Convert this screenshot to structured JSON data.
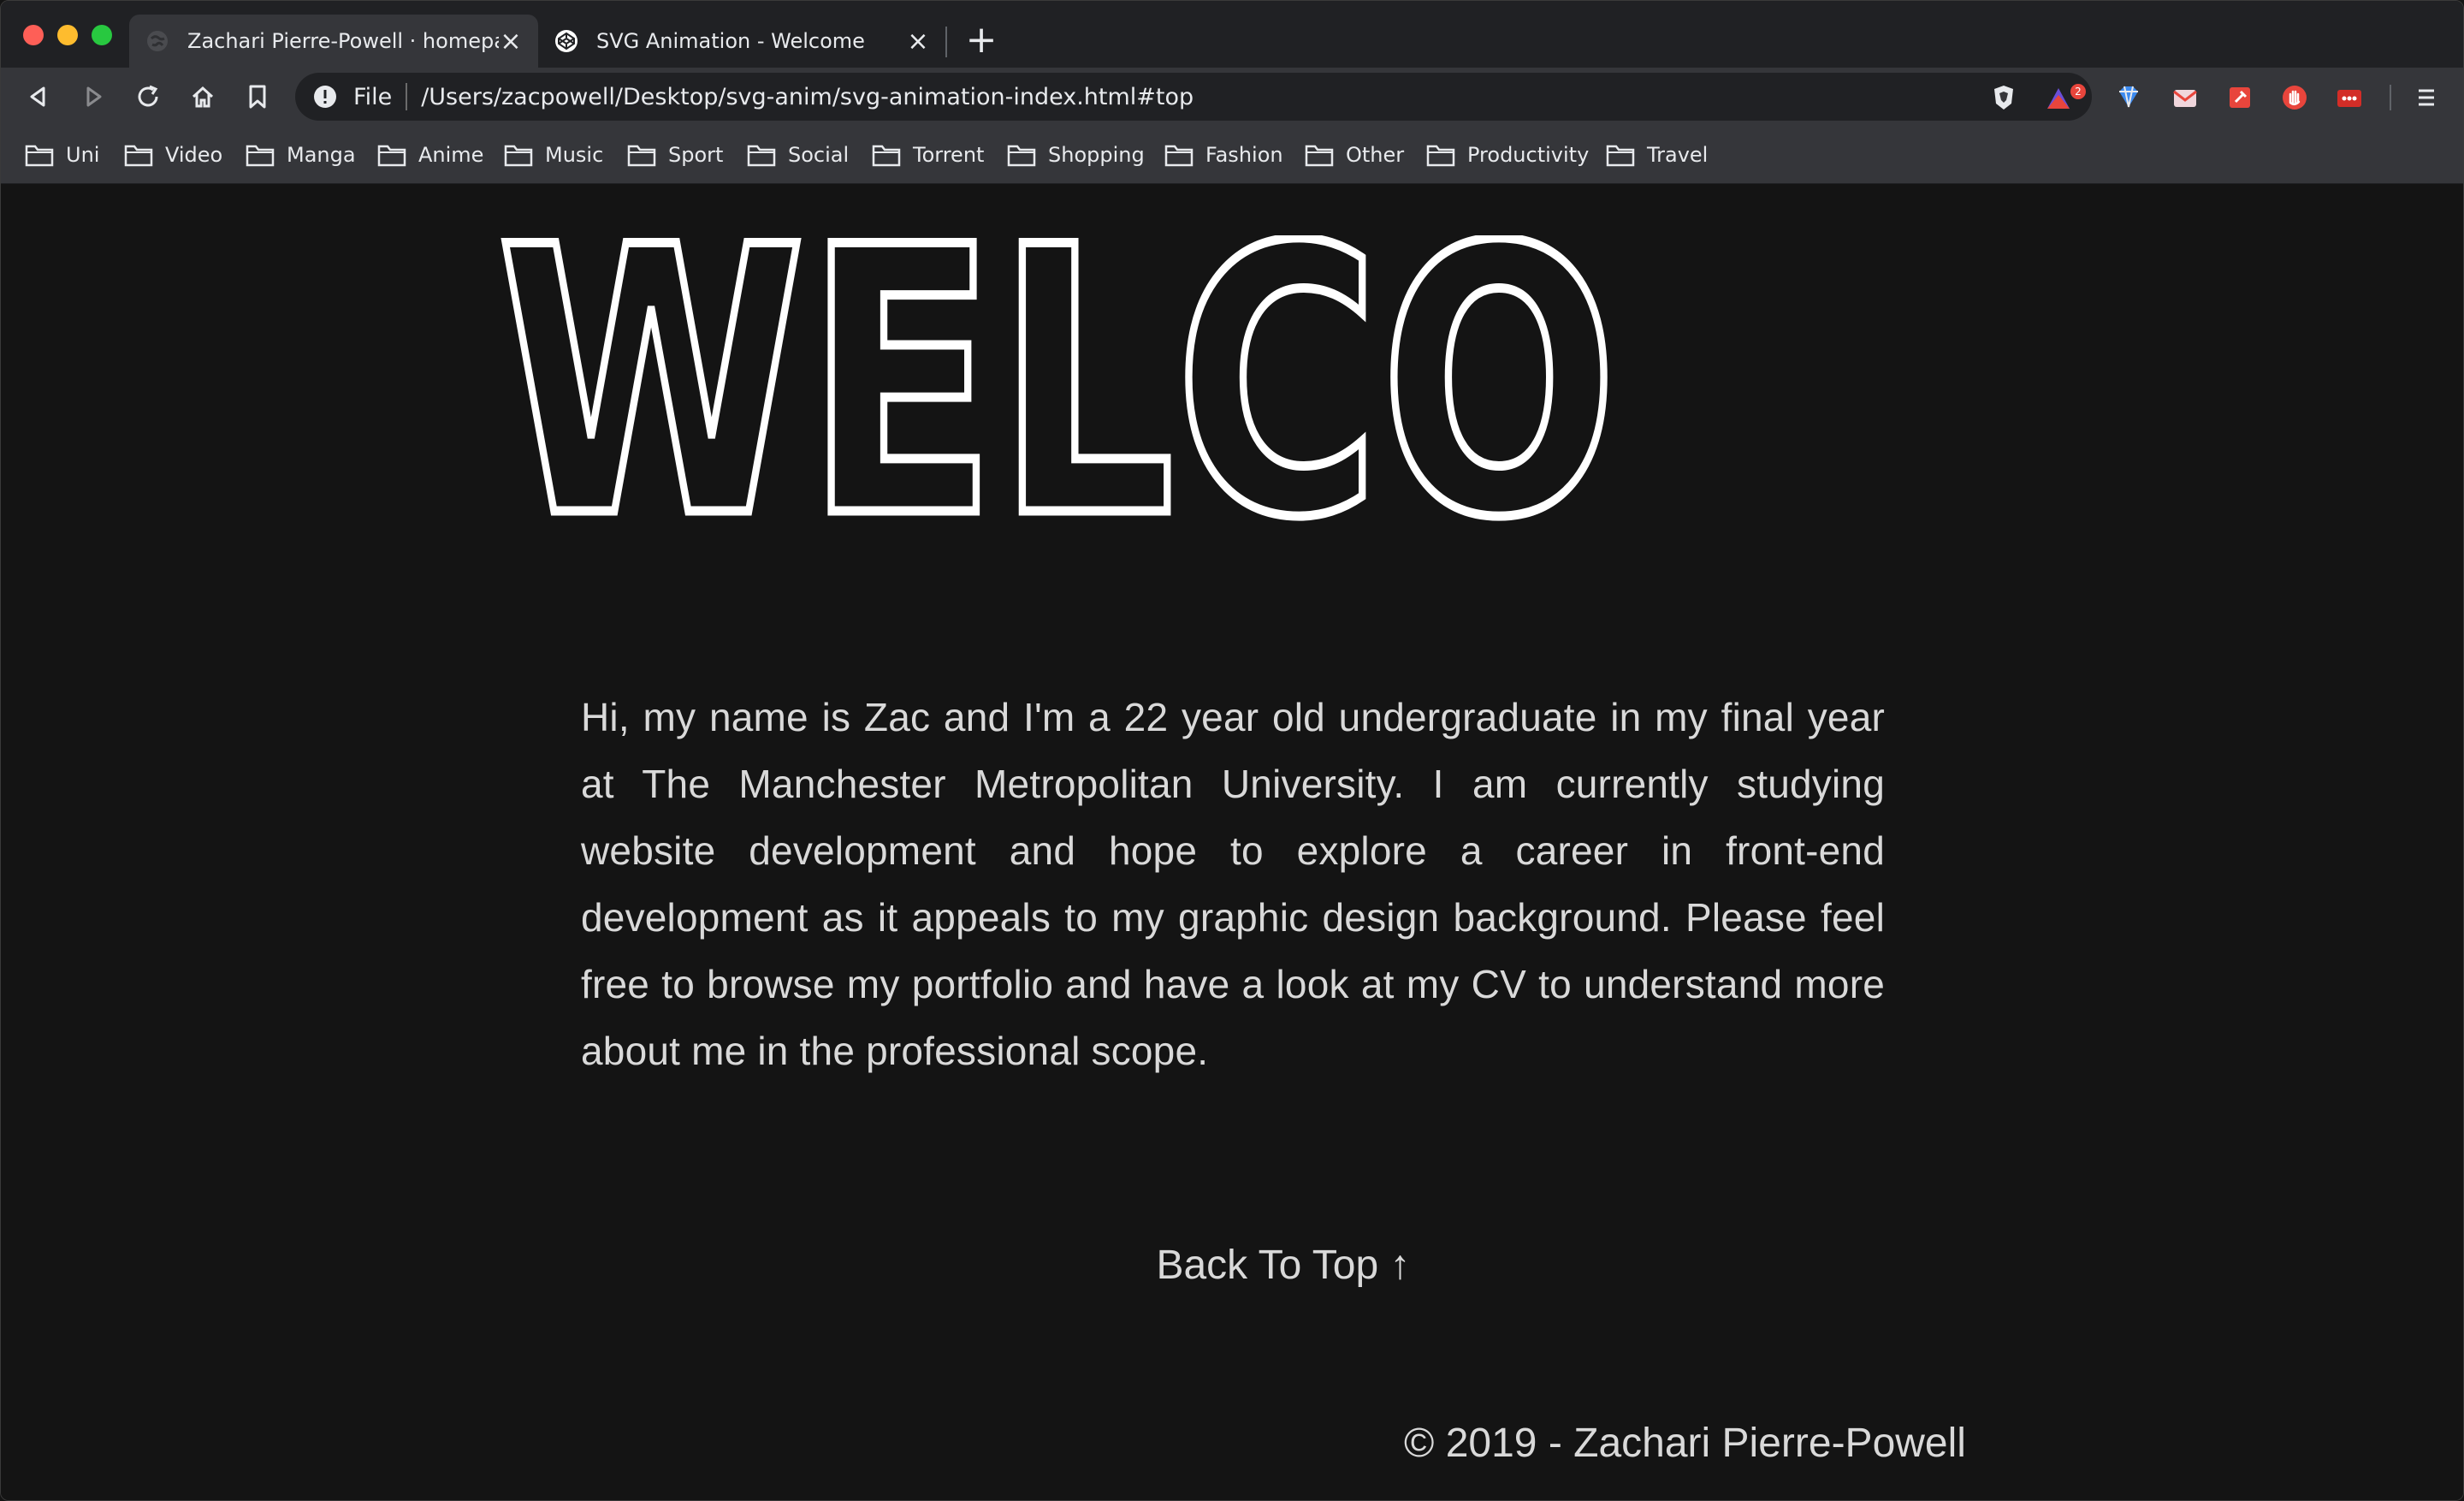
{
  "browser": {
    "tabs": [
      {
        "title": "Zachari Pierre-Powell · homepage",
        "close": "×"
      },
      {
        "title": "SVG Animation - Welcome",
        "close": "×"
      }
    ],
    "new_tab": "+",
    "address": {
      "scheme": "File",
      "url": "/Users/zacpowell/Desktop/svg-anim/svg-animation-index.html#top"
    },
    "extension_badge": "2",
    "bookmarks": [
      "Uni",
      "Video",
      "Manga",
      "Anime",
      "Music",
      "Sport",
      "Social",
      "Torrent",
      "Shopping",
      "Fashion",
      "Other",
      "Productivity",
      "Travel"
    ]
  },
  "page": {
    "welcome_text": "WELCO",
    "intro": "Hi, my name is Zac and I'm a 22 year old undergraduate in my final year at The Manchester Metropolitan University. I am currently studying website development and hope to explore a career in front-end development as it appeals to my graphic design background. Please feel free to browse my portfolio and have a look at my CV to understand more about me in the professional scope.",
    "back_to_top": "Back To Top ↑",
    "footer": "© 2019 - Zachari Pierre-Powell"
  },
  "colors": {
    "page_bg": "#141414",
    "chrome_bg": "#35363a",
    "text": "#d9d9d9",
    "badge": "#e8453c"
  }
}
